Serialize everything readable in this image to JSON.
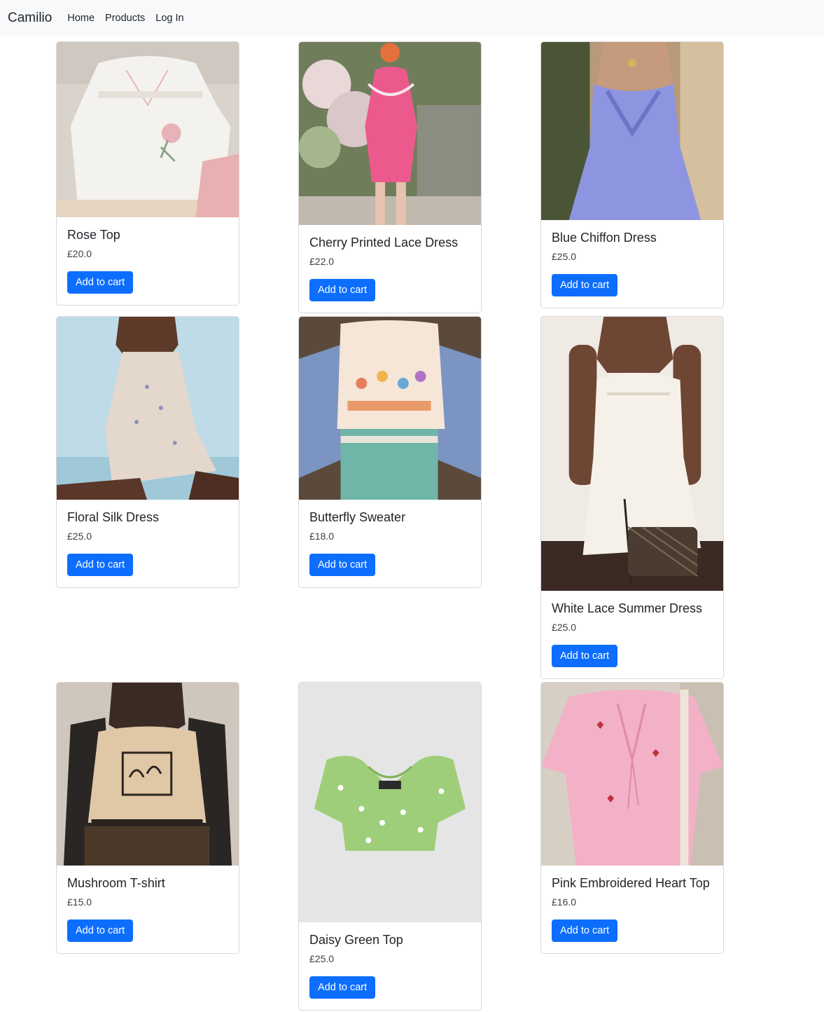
{
  "navbar": {
    "brand": "Camilio",
    "links": [
      {
        "label": "Home"
      },
      {
        "label": "Products"
      },
      {
        "label": "Log In"
      }
    ]
  },
  "products": [
    {
      "name": "Rose Top",
      "price": "£20.0",
      "button": "Add to cart"
    },
    {
      "name": "Cherry Printed Lace Dress",
      "price": "£22.0",
      "button": "Add to cart"
    },
    {
      "name": "Blue Chiffon Dress",
      "price": "£25.0",
      "button": "Add to cart"
    },
    {
      "name": "Floral Silk Dress",
      "price": "£25.0",
      "button": "Add to cart"
    },
    {
      "name": "Butterfly Sweater",
      "price": "£18.0",
      "button": "Add to cart"
    },
    {
      "name": "White Lace Summer Dress",
      "price": "£25.0",
      "button": "Add to cart"
    },
    {
      "name": "Mushroom T-shirt",
      "price": "£15.0",
      "button": "Add to cart"
    },
    {
      "name": "Daisy Green Top",
      "price": "£25.0",
      "button": "Add to cart"
    },
    {
      "name": "Pink Embroidered Heart Top",
      "price": "£16.0",
      "button": "Add to cart"
    }
  ],
  "colors": {
    "navbar_bg": "#f8f9fa",
    "button_bg": "#0d6efd",
    "button_text": "#ffffff"
  }
}
